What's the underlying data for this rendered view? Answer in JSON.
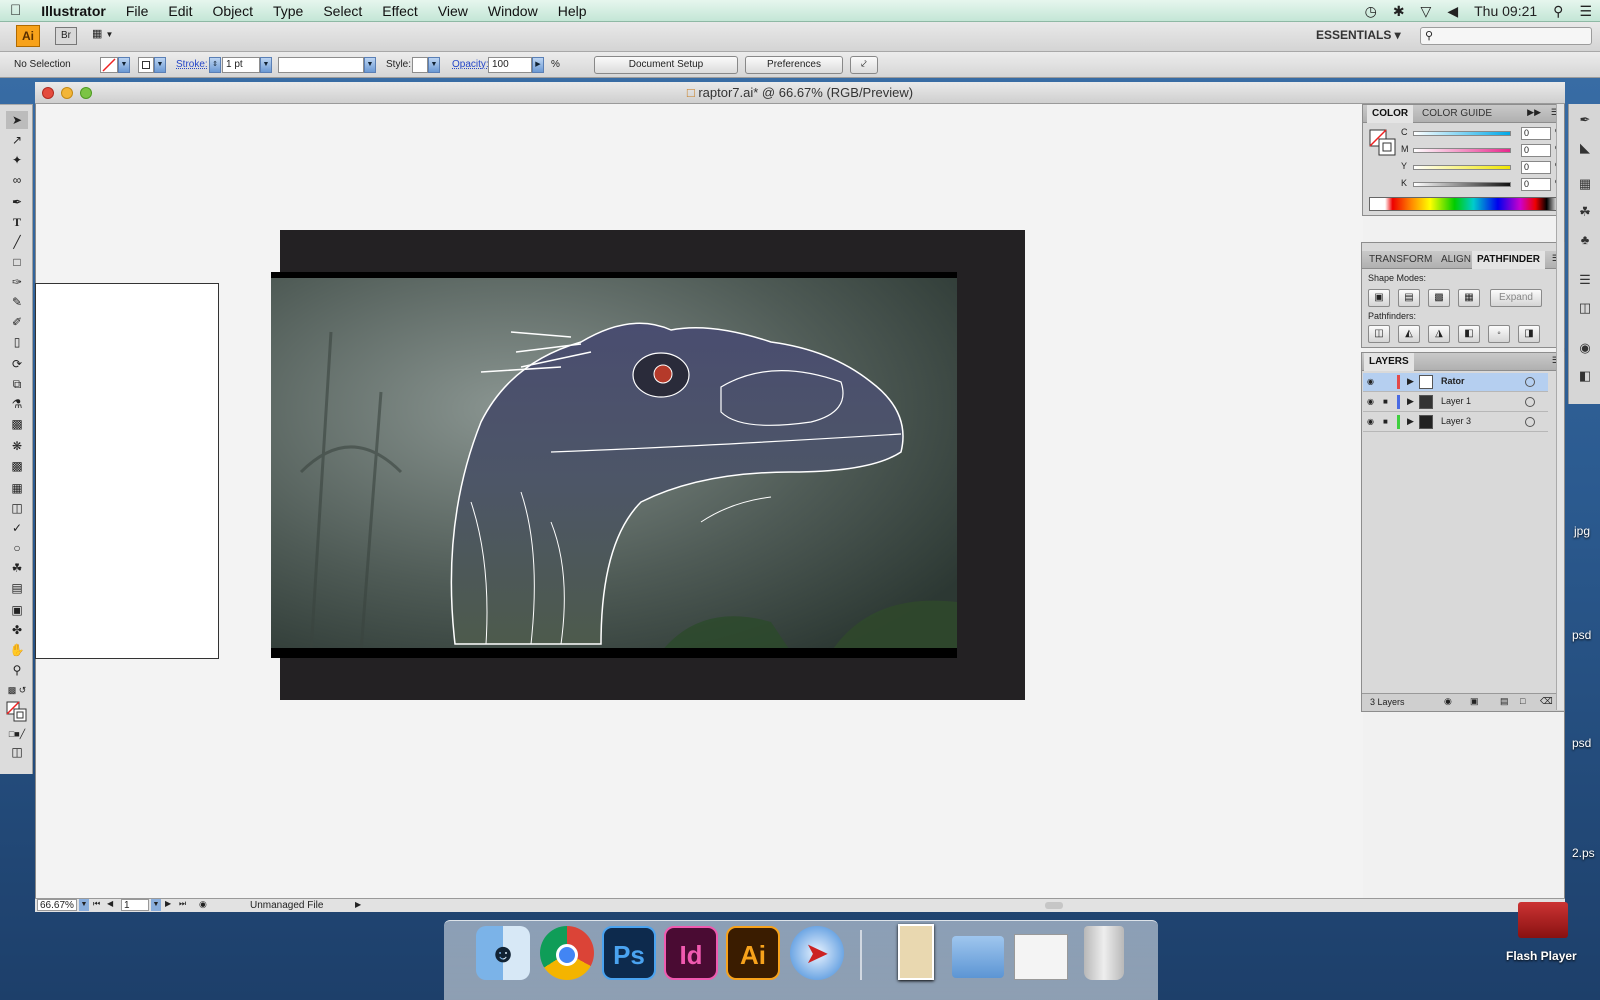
{
  "menubar": {
    "app_name": "Illustrator",
    "items": [
      "File",
      "Edit",
      "Object",
      "Type",
      "Select",
      "Effect",
      "View",
      "Window",
      "Help"
    ],
    "clock": "Thu 09:21"
  },
  "appbar": {
    "ai_logo": "Ai",
    "bridge": "Br",
    "workspace": "ESSENTIALS ▾"
  },
  "control_bar": {
    "selection": "No Selection",
    "stroke_label": "Stroke:",
    "stroke_value": "1 pt",
    "style_label": "Style:",
    "opacity_label": "Opacity:",
    "opacity_value": "100",
    "opacity_unit": "%",
    "document_setup": "Document Setup",
    "preferences": "Preferences"
  },
  "document": {
    "title": "raptor7.ai* @ 66.67% (RGB/Preview)",
    "zoom": "66.67%",
    "page": "1",
    "status": "Unmanaged File"
  },
  "color_panel": {
    "tabs": [
      "COLOR",
      "COLOR GUIDE"
    ],
    "channels": [
      {
        "label": "C",
        "value": "0",
        "unit": "%"
      },
      {
        "label": "M",
        "value": "0",
        "unit": "%"
      },
      {
        "label": "Y",
        "value": "0",
        "unit": "%"
      },
      {
        "label": "K",
        "value": "0",
        "unit": "%"
      }
    ]
  },
  "pathfinder_panel": {
    "tabs": [
      "TRANSFORM",
      "ALIGN",
      "PATHFINDER"
    ],
    "shape_modes_label": "Shape Modes:",
    "expand_label": "Expand",
    "pathfinders_label": "Pathfinders:"
  },
  "layers_panel": {
    "title": "LAYERS",
    "layers": [
      {
        "name": "Rator",
        "color": "#e34a4a",
        "selected": true
      },
      {
        "name": "Layer 1",
        "color": "#4a6be3",
        "selected": false
      },
      {
        "name": "Layer 3",
        "color": "#3fcf3f",
        "selected": false
      }
    ],
    "count": "3 Layers"
  },
  "desktop": {
    "labels": [
      "jpg",
      "psd",
      "psd",
      "2.ps"
    ],
    "flash_player": "Flash Player"
  },
  "dock": {
    "apps": [
      {
        "name": "Finder",
        "label": ""
      },
      {
        "name": "Chrome",
        "label": ""
      },
      {
        "name": "Photoshop",
        "label": "Ps"
      },
      {
        "name": "InDesign",
        "label": "Id"
      },
      {
        "name": "Illustrator",
        "label": "Ai"
      },
      {
        "name": "Safari",
        "label": ""
      }
    ]
  }
}
